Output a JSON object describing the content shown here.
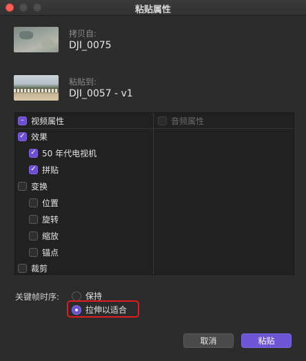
{
  "window": {
    "title": "粘贴属性"
  },
  "source": {
    "label": "拷贝自:",
    "name": "DJI_0075"
  },
  "destination": {
    "label": "粘贴到:",
    "name": "DJI_0057 - v1"
  },
  "video": {
    "header": "视频属性",
    "items": [
      {
        "label": "效果",
        "checked": true
      },
      {
        "label": "50 年代电视机",
        "checked": true
      },
      {
        "label": "拼贴",
        "checked": true
      },
      {
        "label": "变换",
        "checked": false
      },
      {
        "label": "位置",
        "checked": false
      },
      {
        "label": "旋转",
        "checked": false
      },
      {
        "label": "缩放",
        "checked": false
      },
      {
        "label": "锚点",
        "checked": false
      },
      {
        "label": "裁剪",
        "checked": false
      }
    ]
  },
  "audio": {
    "header": "音频属性"
  },
  "keyframes": {
    "label": "关键帧时序:",
    "options": [
      "保持",
      "拉伸以适合"
    ],
    "selected": "拉伸以适合"
  },
  "buttons": {
    "cancel": "取消",
    "paste": "粘贴"
  },
  "colors": {
    "accent": "#6e4fd1",
    "highlight": "#e21d1d"
  }
}
